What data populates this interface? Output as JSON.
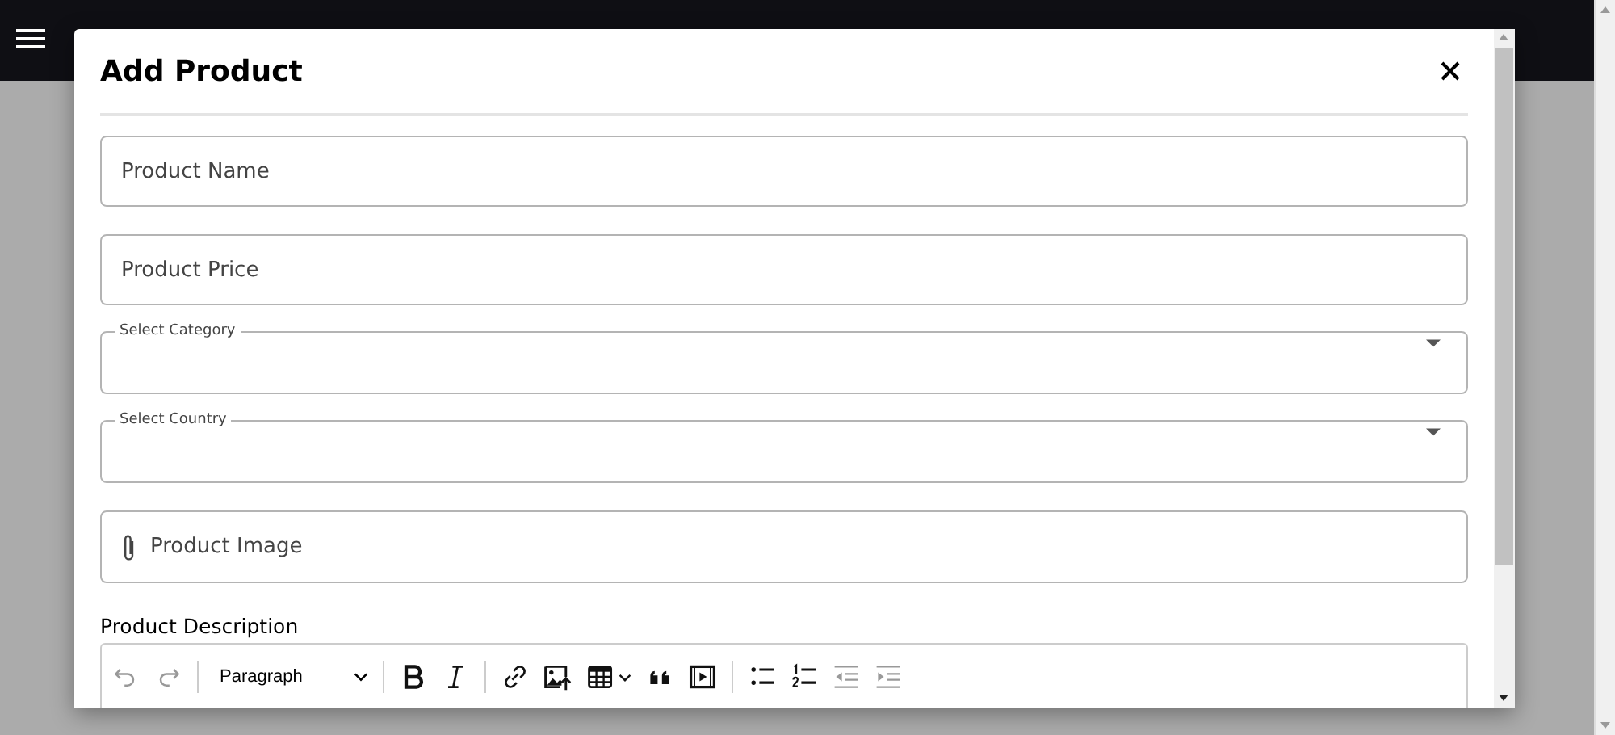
{
  "dialog": {
    "title": "Add Product",
    "fields": [
      {
        "kind": "text",
        "placeholder": "Product Name"
      },
      {
        "kind": "text",
        "placeholder": "Product Price"
      },
      {
        "kind": "select",
        "label": "Select Category"
      },
      {
        "kind": "select",
        "label": "Select Country"
      },
      {
        "kind": "file",
        "placeholder": "Product Image"
      }
    ],
    "editor": {
      "label": "Product Description",
      "toolbar": [
        {
          "kind": "undo",
          "disabled": true
        },
        {
          "kind": "redo",
          "disabled": true
        },
        {
          "kind": "separator"
        },
        {
          "kind": "heading",
          "value": "Paragraph",
          "disabled": false
        },
        {
          "kind": "separator"
        },
        {
          "kind": "bold",
          "disabled": false
        },
        {
          "kind": "italic",
          "disabled": false
        },
        {
          "kind": "separator"
        },
        {
          "kind": "link",
          "disabled": false
        },
        {
          "kind": "image",
          "disabled": false
        },
        {
          "kind": "table",
          "disabled": false
        },
        {
          "kind": "quote",
          "disabled": false
        },
        {
          "kind": "media",
          "disabled": false
        },
        {
          "kind": "separator"
        },
        {
          "kind": "bulleted_list",
          "disabled": false
        },
        {
          "kind": "numbered_list",
          "disabled": false
        },
        {
          "kind": "outdent",
          "disabled": true
        },
        {
          "kind": "indent",
          "disabled": true
        }
      ]
    }
  }
}
